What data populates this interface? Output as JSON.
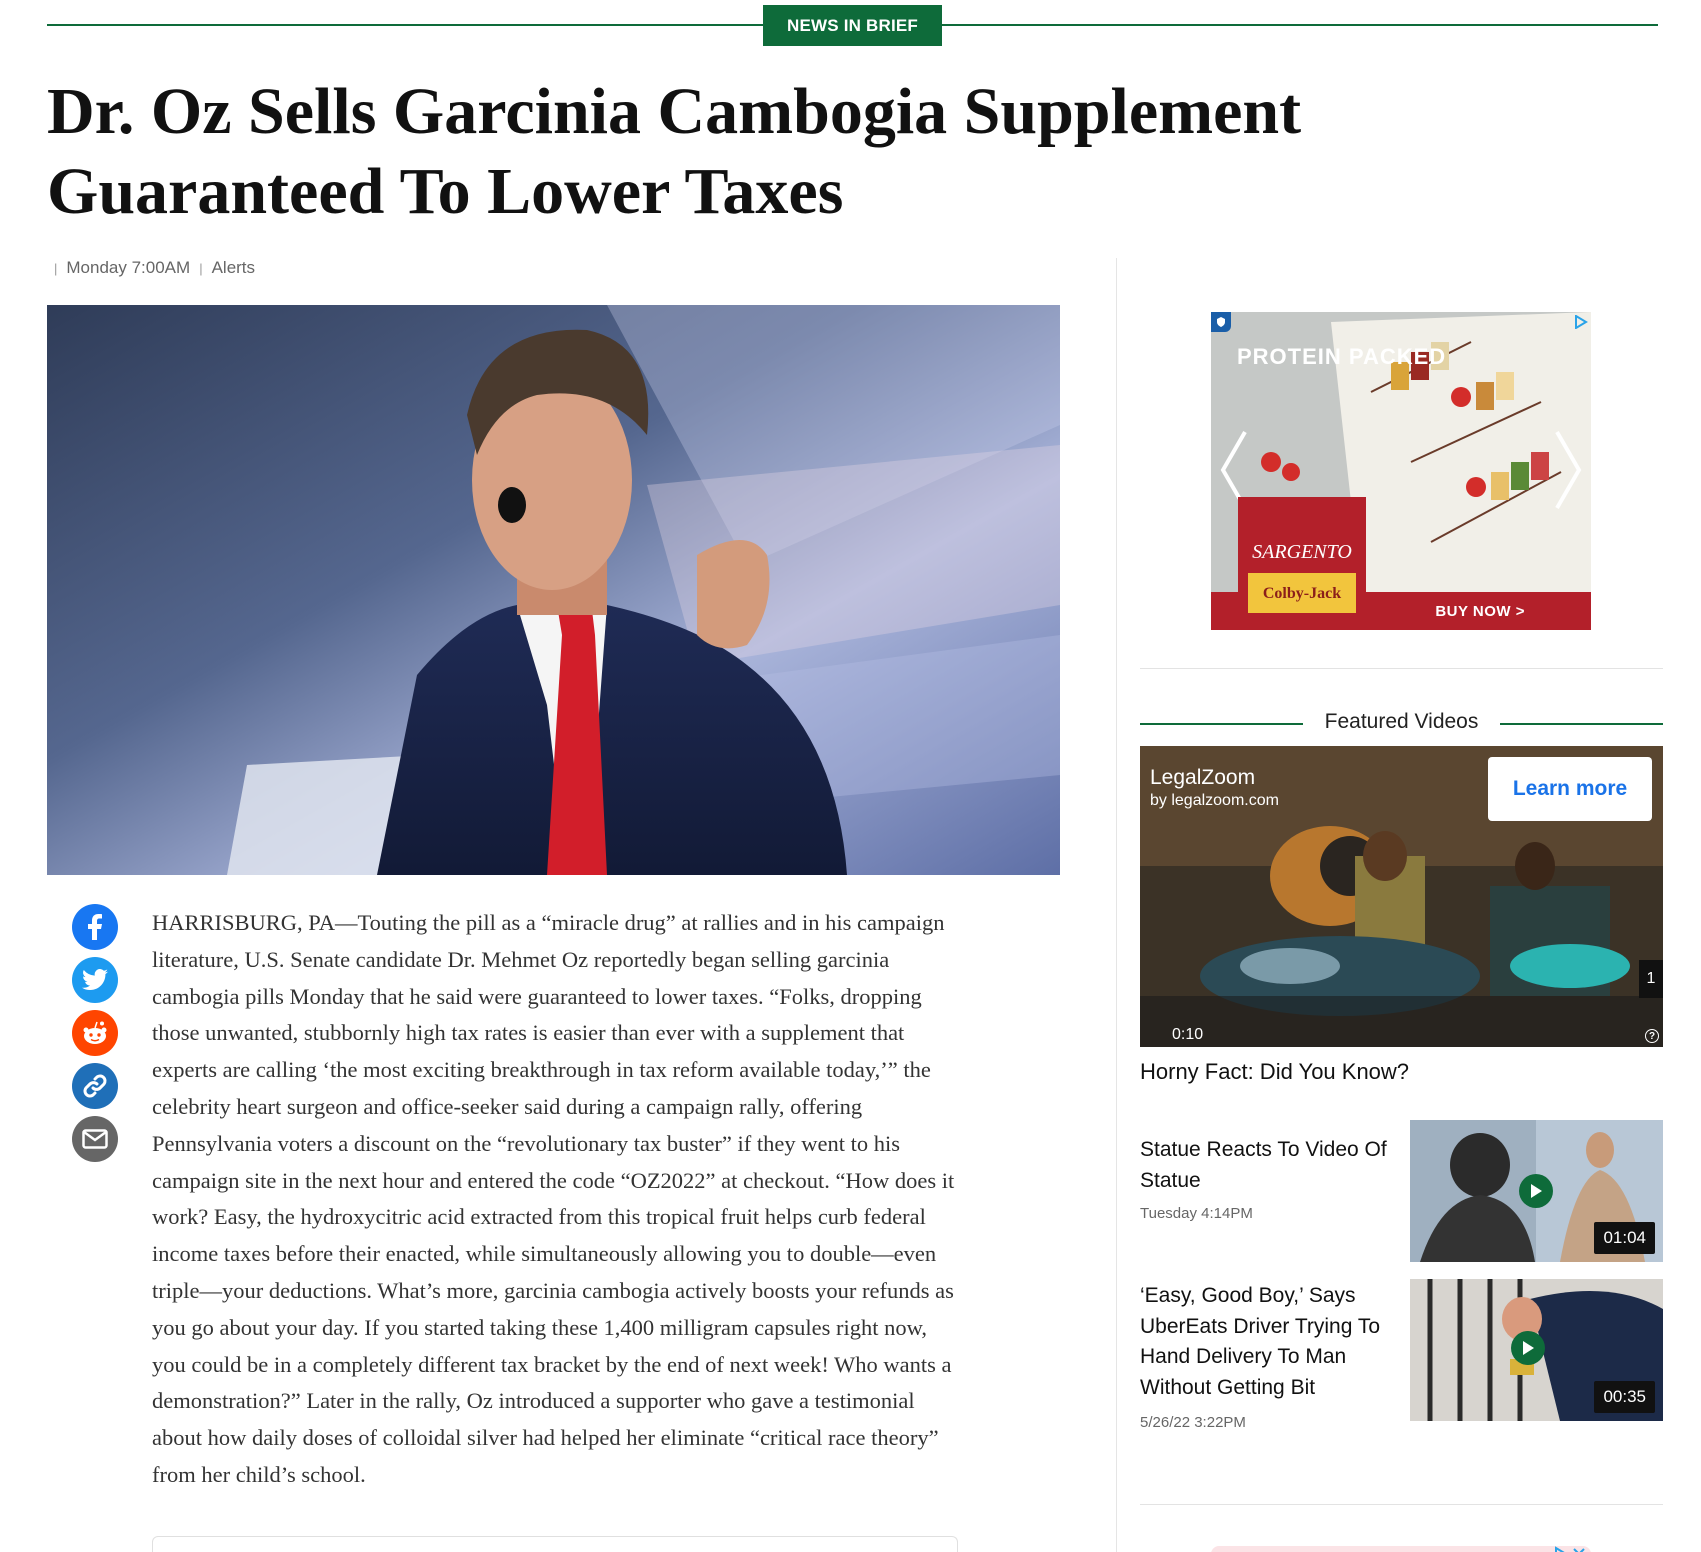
{
  "section_tag": "NEWS IN BRIEF",
  "headline_line1": "Dr. Oz Sells Garcinia Cambogia Supplement",
  "headline_line2": "Guaranteed To Lower Taxes",
  "byline": {
    "date": "Monday 7:00AM",
    "category": "Alerts"
  },
  "hero_image": {
    "alt": "Dr. Mehmet Oz speaking at podium"
  },
  "share_icons": [
    "facebook-icon",
    "twitter-icon",
    "reddit-icon",
    "link-icon",
    "email-icon"
  ],
  "article": {
    "body": "HARRISBURG, PA—Touting the pill as a “miracle drug” at rallies and in his campaign literature, U.S. Senate candidate Dr. Mehmet Oz reportedly began selling garcinia cambogia pills Monday that he said were guaranteed to lower taxes. “Folks, dropping those unwanted, stubbornly high tax rates is easier than ever with a supplement that experts are calling ‘the most exciting breakthrough in tax reform available today,’” the celebrity heart surgeon and office-seeker said during a campaign rally, offering Pennsylvania voters a discount on the “revolutionary tax buster” if they went to his campaign site in the next hour and entered the code “OZ2022” at checkout. “How does it work? Easy, the hydroxycitric acid extracted from this tropical fruit helps curb federal income taxes before their enacted, while simultaneously allowing you to double—even triple—your deductions. What’s more, garcinia cambogia actively boosts your refunds as you go about your day. If you started taking these 1,400 milligram capsules right now, you could be in a completely different tax bracket by the end of next week! Who wants a demonstration?” Later in the rally, Oz introduced a supporter who gave a testimonial about how daily doses of colloidal silver had helped her eliminate “critical race theory” from her child’s school."
  },
  "ad": {
    "headline": "PROTEIN PACKED",
    "brand": "SARGENTO",
    "product": "Colby-Jack",
    "cta": "BUY NOW >"
  },
  "featured_videos": {
    "title": "Featured Videos",
    "player": {
      "advertiser": "LegalZoom",
      "advertiser_sub": "by legalzoom.com",
      "cta": "Learn more",
      "time": "0:10",
      "count": "1",
      "help": "?"
    },
    "main_caption": "Horny Fact: Did You Know?",
    "items": [
      {
        "title": "Statue Reacts To Video Of Statue",
        "date": "Tuesday 4:14PM",
        "duration": "01:04"
      },
      {
        "title": "‘Easy, Good Boy,’ Says UberEats Driver Trying To Hand Delivery To Man Without Getting Bit",
        "date": "5/26/22 3:22PM",
        "duration": "00:35"
      }
    ]
  },
  "colors": {
    "accent_green": "#0e6b3a",
    "ad_red": "#b3202a",
    "link_blue": "#1a73e8"
  }
}
